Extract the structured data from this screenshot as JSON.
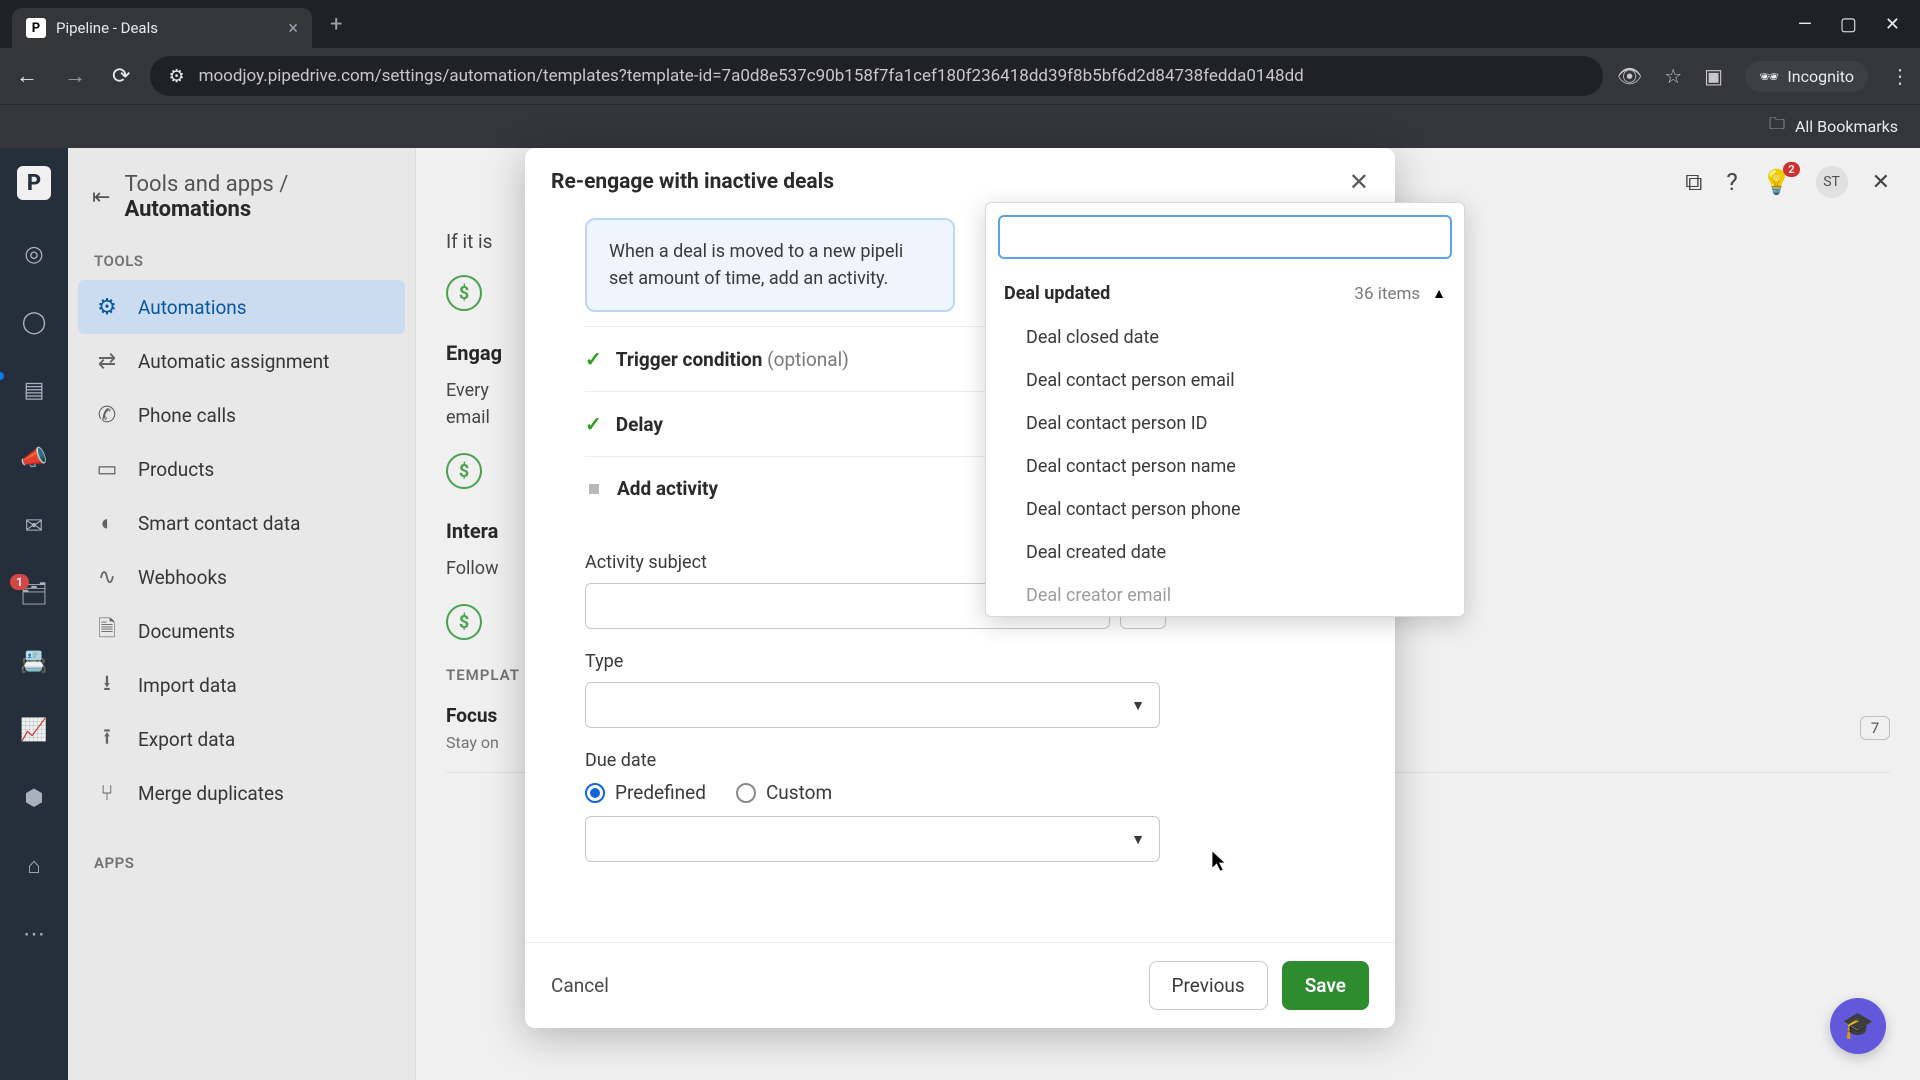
{
  "browser": {
    "tab_title": "Pipeline - Deals",
    "tab_favicon": "P",
    "url": "moodjoy.pipedrive.com/settings/automation/templates?template-id=7a0d8e537c90b158f7fa1cef180f236418dd39f8b5bf6d2d84738fedda0148dd",
    "incognito": "Incognito",
    "all_bookmarks": "All Bookmarks"
  },
  "sidebar": {
    "breadcrumb_pre": "Tools and apps",
    "breadcrumb_current": "Automations",
    "section_tools": "TOOLS",
    "section_apps": "APPS",
    "items": [
      "Automations",
      "Automatic assignment",
      "Phone calls",
      "Products",
      "Smart contact data",
      "Webhooks",
      "Documents",
      "Import data",
      "Export data",
      "Merge duplicates"
    ]
  },
  "topbar": {
    "avatar": "ST",
    "notify_count": "2"
  },
  "background": {
    "if_it_is": "If it is",
    "section2_title": "Engag",
    "section2_desc1": "Every",
    "section2_desc2": "email",
    "section3_title": "Intera",
    "section3_desc": "Follow",
    "templates_label": "TEMPLAT",
    "tmpl1_title": "Focus",
    "tmpl1_meta": "Stay on",
    "tmpl_count": "7"
  },
  "modal": {
    "title": "Re-engage with inactive deals",
    "info": "When a deal is moved to a new pipeli set amount of time, add an activity.",
    "step1_label": "Trigger condition",
    "step1_optional": "(optional)",
    "step2_label": "Delay",
    "step3_label": "Add activity",
    "field_subject": "Activity subject",
    "field_type": "Type",
    "field_due": "Due date",
    "radio_predefined": "Predefined",
    "radio_custom": "Custom",
    "btn_cancel": "Cancel",
    "btn_prev": "Previous",
    "btn_save": "Save"
  },
  "dropdown": {
    "group_title": "Deal updated",
    "group_count": "36 items",
    "items": [
      "Deal closed date",
      "Deal contact person email",
      "Deal contact person ID",
      "Deal contact person name",
      "Deal contact person phone",
      "Deal created date",
      "Deal creator email"
    ]
  }
}
